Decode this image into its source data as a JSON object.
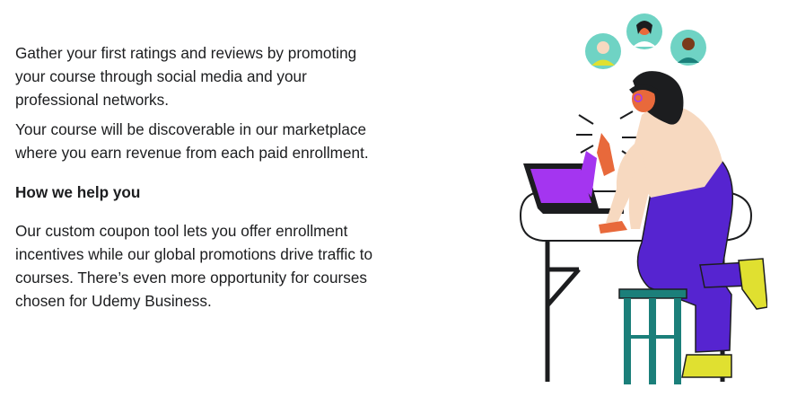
{
  "section": {
    "paragraphs": [
      "Gather your first ratings and reviews by promoting your course through social media and your professional networks.",
      "Your course will be discoverable in our marketplace where you earn revenue from each paid enrollment."
    ],
    "heading": "How we help you",
    "help_paragraph": "Our custom coupon tool lets you offer enrollment incentives while our global promotions drive traffic to courses. There’s even more opportunity for courses chosen for Udemy Business."
  },
  "illustration": {
    "colors": {
      "teal_bubble": "#6fd3c4",
      "pants": "#5624d0",
      "shirt": "#f7d9c0",
      "skin": "#e8693b",
      "shoe": "#e0e030",
      "stool": "#1b7f7a",
      "screen": "#a435f0",
      "line": "#1c1d1f"
    }
  }
}
